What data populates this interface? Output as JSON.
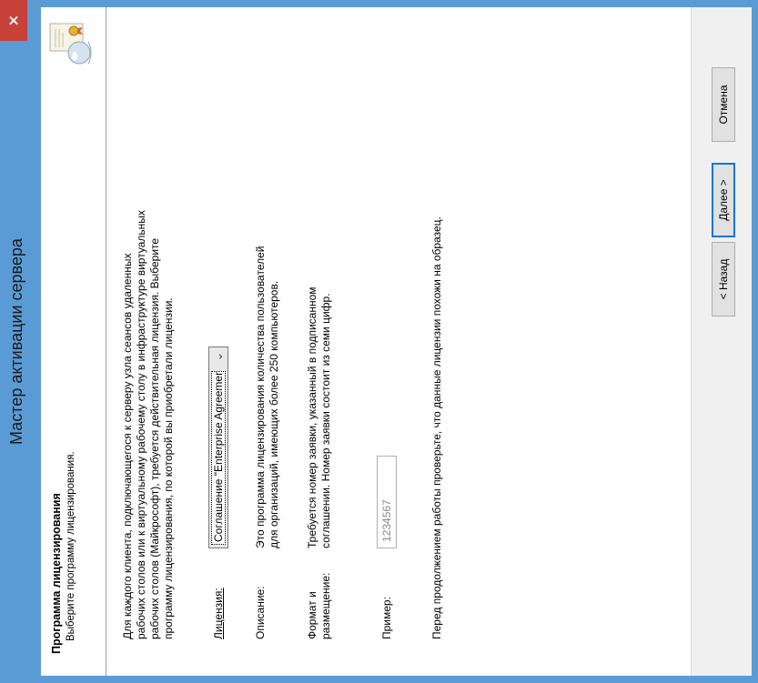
{
  "window": {
    "title": "Мастер активации сервера",
    "close_label": "×"
  },
  "header": {
    "title": "Программа лицензирования",
    "subtitle": "Выберите программу лицензирования."
  },
  "content": {
    "intro_lines": [
      "Для каждого клиента, подключающегося к серверу узла сеансов удаленных",
      "рабочих столов или к виртуальному рабочему столу в инфраструктуре виртуальных",
      "рабочих столов (Майкрософт), требуется действительная лицензия. Выберите",
      "программу лицензирования, по которой вы приобретали лицензии."
    ],
    "license_label": "Лицензия:",
    "license_selected": "Соглашение \"Enterprise Agreement\"",
    "description_label": "Описание:",
    "description_lines": [
      "Это программа лицензирования количества пользователей",
      "для организаций, имеющих более 250 компьютеров."
    ],
    "format_label_lines": [
      "Формат и",
      "размещение:"
    ],
    "format_lines": [
      "Требуется номер заявки, указанный в подписанном",
      "соглашении. Номер заявки состоит из семи цифр."
    ],
    "sample_label": "Пример:",
    "sample_value": "1234567",
    "note": "Перед продолжением работы проверьте, что данные лицензии похожи на образец."
  },
  "footer": {
    "back_label": "< Назад",
    "next_label": "Далее >",
    "cancel_label": "Отмена"
  },
  "colors": {
    "title_bar": "#5b9bd5",
    "close_button": "#c7403a",
    "default_button_border": "#0078d7"
  }
}
